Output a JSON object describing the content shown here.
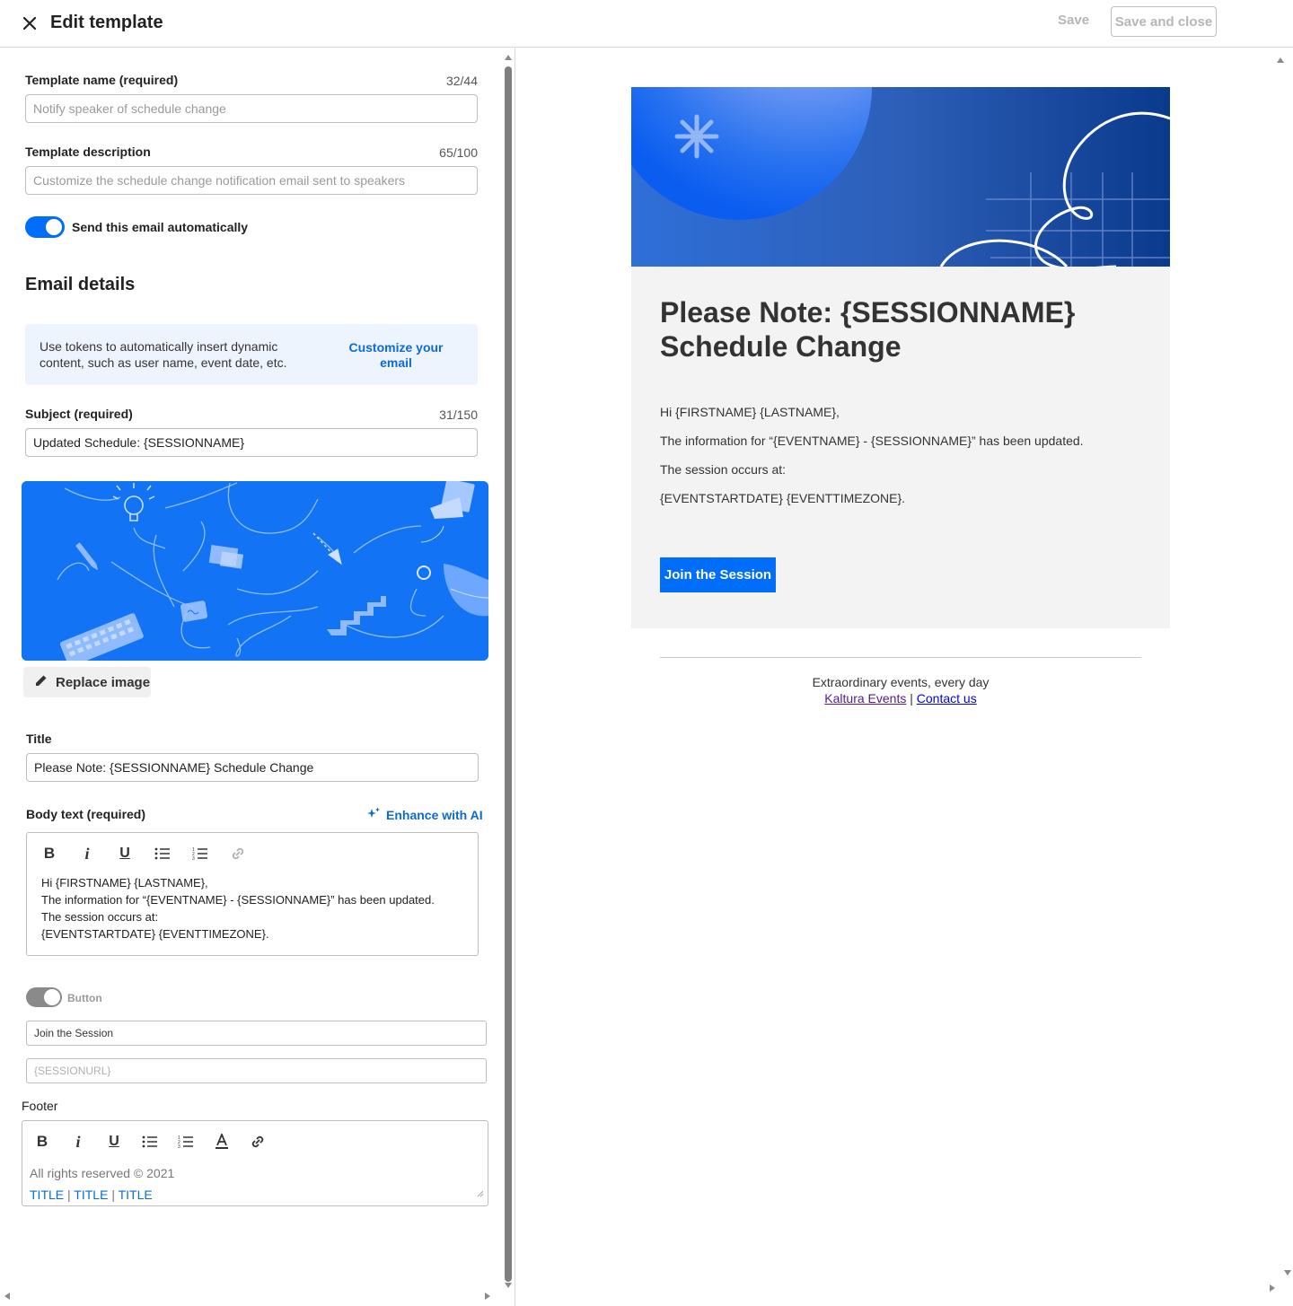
{
  "header": {
    "title": "Edit template",
    "save_label": "Save",
    "save_close_label": "Save and close"
  },
  "form": {
    "template_name": {
      "label": "Template name (required)",
      "count": "32/44",
      "placeholder": "Notify speaker of schedule change"
    },
    "template_description": {
      "label": "Template description",
      "count": "65/100",
      "placeholder": "Customize the schedule change notification email sent to speakers"
    },
    "auto_send": {
      "label": "Send this email automatically",
      "enabled": true
    },
    "email_details_heading": "Email details",
    "info": {
      "line1": "Use tokens to automatically insert dynamic",
      "line2": "content, such as user name, event date, etc.",
      "link_line1": "Customize your",
      "link_line2": "email"
    },
    "subject": {
      "label": "Subject (required)",
      "count": "31/150",
      "value": "Updated Schedule: {SESSIONNAME}"
    },
    "replace_image_label": "Replace image",
    "title": {
      "label": "Title",
      "value": "Please Note: {SESSIONNAME} Schedule Change"
    },
    "body": {
      "label": "Body text (required)",
      "enhance_label": "Enhance with AI",
      "lines": [
        "Hi {FIRSTNAME} {LASTNAME},",
        "The information for “{EVENTNAME} - {SESSIONNAME}” has been updated.",
        "The session occurs at:",
        "{EVENTSTARTDATE} {EVENTTIMEZONE}."
      ]
    },
    "button": {
      "label": "Button",
      "enabled": false,
      "text_value": "Join the Session",
      "url_placeholder": "{SESSIONURL}"
    },
    "footer": {
      "label": "Footer",
      "rights": "All rights reserved © 2021",
      "links": [
        "TITLE",
        "TITLE",
        "TITLE"
      ],
      "separator": "|"
    }
  },
  "preview": {
    "title_line1": "Please Note: {SESSIONNAME}",
    "title_line2": "Schedule Change",
    "body_lines": [
      "Hi {FIRSTNAME} {LASTNAME},",
      "The information for “{EVENTNAME} - {SESSIONNAME}” has been updated.",
      "The session occurs at:",
      "{EVENTSTARTDATE} {EVENTTIMEZONE}."
    ],
    "cta_label": "Join the Session",
    "tagline": "Extraordinary events, every day",
    "link_kaltura": "Kaltura Events",
    "link_separator": "|",
    "link_contact": "Contact us"
  },
  "colors": {
    "accent": "#006efa",
    "link": "#0b6bd6",
    "banner_dark": "#0b3d91"
  },
  "icons": [
    "close-icon",
    "pencil-icon",
    "sparkle-icon",
    "bold-icon",
    "italic-icon",
    "underline-icon",
    "bulleted-list-icon",
    "numbered-list-icon",
    "link-icon",
    "text-color-icon"
  ]
}
